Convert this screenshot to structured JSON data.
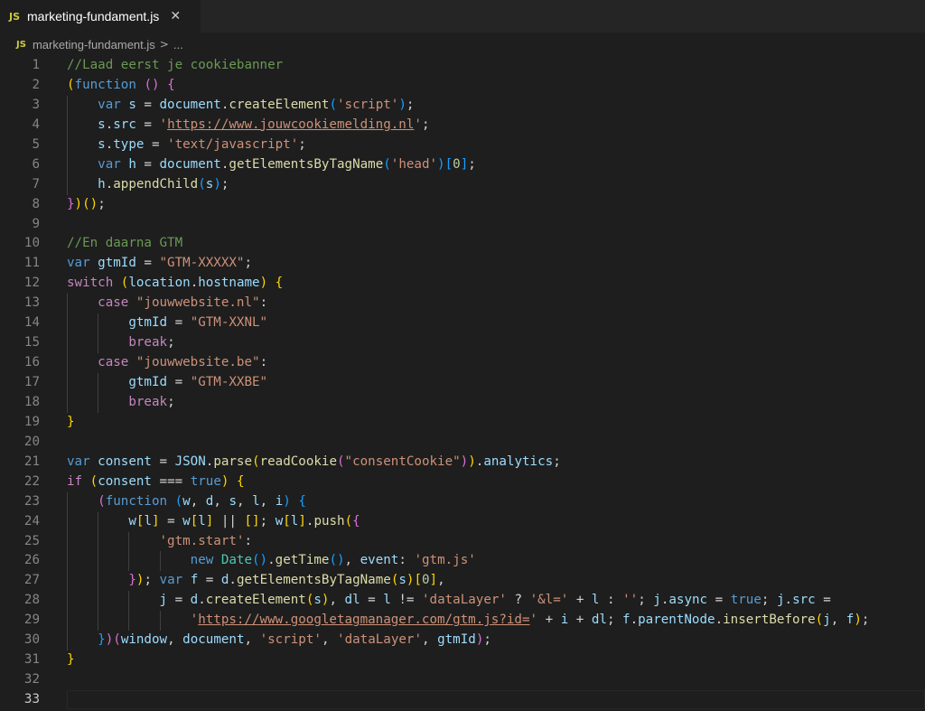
{
  "tab": {
    "badge": "JS",
    "title": "marketing-fundament.js",
    "close_glyph": "✕"
  },
  "breadcrumb": {
    "badge": "JS",
    "file": "marketing-fundament.js",
    "separator": ">",
    "ellipsis": "..."
  },
  "editor": {
    "line_numbers": [
      "1",
      "2",
      "3",
      "4",
      "5",
      "6",
      "7",
      "8",
      "9",
      "10",
      "11",
      "12",
      "13",
      "14",
      "15",
      "16",
      "17",
      "18",
      "19",
      "20",
      "21",
      "22",
      "23",
      "24",
      "25",
      "26",
      "27",
      "28",
      "29",
      "30",
      "31",
      "32",
      "33"
    ],
    "current_line": 33,
    "colors": {
      "background": "#1e1e1e",
      "comment": "#6a9955",
      "keyword": "#569cd6",
      "control": "#c586c0",
      "variable": "#9cdcfe",
      "function": "#dcdcaa",
      "string": "#ce9178",
      "number": "#b5cea8",
      "bracket_gold": "#ffd700",
      "bracket_purple": "#da70d6",
      "bracket_blue": "#179fff"
    },
    "lines": [
      {
        "indent": 0,
        "tokens": [
          [
            "cm",
            "//Laad eerst je cookiebanner"
          ]
        ]
      },
      {
        "indent": 0,
        "tokens": [
          [
            "b1",
            "("
          ],
          [
            "kw",
            "function"
          ],
          [
            "pn",
            " "
          ],
          [
            "b2",
            "()"
          ],
          [
            "pn",
            " "
          ],
          [
            "b2",
            "{"
          ]
        ]
      },
      {
        "indent": 1,
        "tokens": [
          [
            "kw",
            "var"
          ],
          [
            "pn",
            " "
          ],
          [
            "var",
            "s"
          ],
          [
            "pn",
            " = "
          ],
          [
            "var",
            "document"
          ],
          [
            "pn",
            "."
          ],
          [
            "fn",
            "createElement"
          ],
          [
            "b3",
            "("
          ],
          [
            "str",
            "'script'"
          ],
          [
            "b3",
            ")"
          ],
          [
            "pn",
            ";"
          ]
        ]
      },
      {
        "indent": 1,
        "tokens": [
          [
            "var",
            "s"
          ],
          [
            "pn",
            "."
          ],
          [
            "var",
            "src"
          ],
          [
            "pn",
            " = "
          ],
          [
            "str",
            "'"
          ],
          [
            "url",
            "https://www.jouwcookiemelding.nl"
          ],
          [
            "str",
            "'"
          ],
          [
            "pn",
            ";"
          ]
        ]
      },
      {
        "indent": 1,
        "tokens": [
          [
            "var",
            "s"
          ],
          [
            "pn",
            "."
          ],
          [
            "var",
            "type"
          ],
          [
            "pn",
            " = "
          ],
          [
            "str",
            "'text/javascript'"
          ],
          [
            "pn",
            ";"
          ]
        ]
      },
      {
        "indent": 1,
        "tokens": [
          [
            "kw",
            "var"
          ],
          [
            "pn",
            " "
          ],
          [
            "var",
            "h"
          ],
          [
            "pn",
            " = "
          ],
          [
            "var",
            "document"
          ],
          [
            "pn",
            "."
          ],
          [
            "fn",
            "getElementsByTagName"
          ],
          [
            "b3",
            "("
          ],
          [
            "str",
            "'head'"
          ],
          [
            "b3",
            ")"
          ],
          [
            "b3",
            "["
          ],
          [
            "num",
            "0"
          ],
          [
            "b3",
            "]"
          ],
          [
            "pn",
            ";"
          ]
        ]
      },
      {
        "indent": 1,
        "tokens": [
          [
            "var",
            "h"
          ],
          [
            "pn",
            "."
          ],
          [
            "fn",
            "appendChild"
          ],
          [
            "b3",
            "("
          ],
          [
            "var",
            "s"
          ],
          [
            "b3",
            ")"
          ],
          [
            "pn",
            ";"
          ]
        ]
      },
      {
        "indent": 0,
        "tokens": [
          [
            "b2",
            "}"
          ],
          [
            "b1",
            ")"
          ],
          [
            "b1",
            "()"
          ],
          [
            "pn",
            ";"
          ]
        ]
      },
      {
        "indent": 0,
        "tokens": []
      },
      {
        "indent": 0,
        "tokens": [
          [
            "cm",
            "//En daarna GTM"
          ]
        ]
      },
      {
        "indent": 0,
        "tokens": [
          [
            "kw",
            "var"
          ],
          [
            "pn",
            " "
          ],
          [
            "var",
            "gtmId"
          ],
          [
            "pn",
            " = "
          ],
          [
            "str",
            "\"GTM-XXXXX\""
          ],
          [
            "pn",
            ";"
          ]
        ]
      },
      {
        "indent": 0,
        "tokens": [
          [
            "ctl",
            "switch"
          ],
          [
            "pn",
            " "
          ],
          [
            "b1",
            "("
          ],
          [
            "var",
            "location"
          ],
          [
            "pn",
            "."
          ],
          [
            "var",
            "hostname"
          ],
          [
            "b1",
            ")"
          ],
          [
            "pn",
            " "
          ],
          [
            "b1",
            "{"
          ]
        ]
      },
      {
        "indent": 1,
        "tokens": [
          [
            "ctl",
            "case"
          ],
          [
            "pn",
            " "
          ],
          [
            "str",
            "\"jouwwebsite.nl\""
          ],
          [
            "pn",
            ":"
          ]
        ]
      },
      {
        "indent": 2,
        "tokens": [
          [
            "var",
            "gtmId"
          ],
          [
            "pn",
            " = "
          ],
          [
            "str",
            "\"GTM-XXNL\""
          ]
        ]
      },
      {
        "indent": 2,
        "tokens": [
          [
            "ctl",
            "break"
          ],
          [
            "pn",
            ";"
          ]
        ]
      },
      {
        "indent": 1,
        "tokens": [
          [
            "ctl",
            "case"
          ],
          [
            "pn",
            " "
          ],
          [
            "str",
            "\"jouwwebsite.be\""
          ],
          [
            "pn",
            ":"
          ]
        ]
      },
      {
        "indent": 2,
        "tokens": [
          [
            "var",
            "gtmId"
          ],
          [
            "pn",
            " = "
          ],
          [
            "str",
            "\"GTM-XXBE\""
          ]
        ]
      },
      {
        "indent": 2,
        "tokens": [
          [
            "ctl",
            "break"
          ],
          [
            "pn",
            ";"
          ]
        ]
      },
      {
        "indent": 0,
        "tokens": [
          [
            "b1",
            "}"
          ]
        ]
      },
      {
        "indent": 0,
        "tokens": []
      },
      {
        "indent": 0,
        "tokens": [
          [
            "kw",
            "var"
          ],
          [
            "pn",
            " "
          ],
          [
            "var",
            "consent"
          ],
          [
            "pn",
            " = "
          ],
          [
            "var",
            "JSON"
          ],
          [
            "pn",
            "."
          ],
          [
            "fn",
            "parse"
          ],
          [
            "b1",
            "("
          ],
          [
            "fn",
            "readCookie"
          ],
          [
            "b2",
            "("
          ],
          [
            "str",
            "\"consentCookie\""
          ],
          [
            "b2",
            ")"
          ],
          [
            "b1",
            ")"
          ],
          [
            "pn",
            "."
          ],
          [
            "var",
            "analytics"
          ],
          [
            "pn",
            ";"
          ]
        ]
      },
      {
        "indent": 0,
        "tokens": [
          [
            "ctl",
            "if"
          ],
          [
            "pn",
            " "
          ],
          [
            "b1",
            "("
          ],
          [
            "var",
            "consent"
          ],
          [
            "pn",
            " === "
          ],
          [
            "kw",
            "true"
          ],
          [
            "b1",
            ")"
          ],
          [
            "pn",
            " "
          ],
          [
            "b1",
            "{"
          ]
        ]
      },
      {
        "indent": 1,
        "tokens": [
          [
            "b2",
            "("
          ],
          [
            "kw",
            "function"
          ],
          [
            "pn",
            " "
          ],
          [
            "b3",
            "("
          ],
          [
            "var",
            "w"
          ],
          [
            "pn",
            ", "
          ],
          [
            "var",
            "d"
          ],
          [
            "pn",
            ", "
          ],
          [
            "var",
            "s"
          ],
          [
            "pn",
            ", "
          ],
          [
            "var",
            "l"
          ],
          [
            "pn",
            ", "
          ],
          [
            "var",
            "i"
          ],
          [
            "b3",
            ")"
          ],
          [
            "pn",
            " "
          ],
          [
            "b3",
            "{"
          ]
        ]
      },
      {
        "indent": 2,
        "tokens": [
          [
            "var",
            "w"
          ],
          [
            "b1",
            "["
          ],
          [
            "var",
            "l"
          ],
          [
            "b1",
            "]"
          ],
          [
            "pn",
            " = "
          ],
          [
            "var",
            "w"
          ],
          [
            "b1",
            "["
          ],
          [
            "var",
            "l"
          ],
          [
            "b1",
            "]"
          ],
          [
            "pn",
            " || "
          ],
          [
            "b1",
            "[]"
          ],
          [
            "pn",
            "; "
          ],
          [
            "var",
            "w"
          ],
          [
            "b1",
            "["
          ],
          [
            "var",
            "l"
          ],
          [
            "b1",
            "]"
          ],
          [
            "pn",
            "."
          ],
          [
            "fn",
            "push"
          ],
          [
            "b1",
            "("
          ],
          [
            "b2",
            "{"
          ]
        ]
      },
      {
        "indent": 3,
        "tokens": [
          [
            "str",
            "'gtm.start'"
          ],
          [
            "pn",
            ":"
          ]
        ]
      },
      {
        "indent": 4,
        "tokens": [
          [
            "kw",
            "new"
          ],
          [
            "pn",
            " "
          ],
          [
            "cls",
            "Date"
          ],
          [
            "b3",
            "()"
          ],
          [
            "pn",
            "."
          ],
          [
            "fn",
            "getTime"
          ],
          [
            "b3",
            "()"
          ],
          [
            "pn",
            ", "
          ],
          [
            "var",
            "event"
          ],
          [
            "pn",
            ": "
          ],
          [
            "str",
            "'gtm.js'"
          ]
        ]
      },
      {
        "indent": 2,
        "tokens": [
          [
            "b2",
            "}"
          ],
          [
            "b1",
            ")"
          ],
          [
            "pn",
            "; "
          ],
          [
            "kw",
            "var"
          ],
          [
            "pn",
            " "
          ],
          [
            "var",
            "f"
          ],
          [
            "pn",
            " = "
          ],
          [
            "var",
            "d"
          ],
          [
            "pn",
            "."
          ],
          [
            "fn",
            "getElementsByTagName"
          ],
          [
            "b1",
            "("
          ],
          [
            "var",
            "s"
          ],
          [
            "b1",
            ")"
          ],
          [
            "b1",
            "["
          ],
          [
            "num",
            "0"
          ],
          [
            "b1",
            "]"
          ],
          [
            "pn",
            ","
          ]
        ]
      },
      {
        "indent": 3,
        "tokens": [
          [
            "var",
            "j"
          ],
          [
            "pn",
            " = "
          ],
          [
            "var",
            "d"
          ],
          [
            "pn",
            "."
          ],
          [
            "fn",
            "createElement"
          ],
          [
            "b1",
            "("
          ],
          [
            "var",
            "s"
          ],
          [
            "b1",
            ")"
          ],
          [
            "pn",
            ", "
          ],
          [
            "var",
            "dl"
          ],
          [
            "pn",
            " = "
          ],
          [
            "var",
            "l"
          ],
          [
            "pn",
            " != "
          ],
          [
            "str",
            "'dataLayer'"
          ],
          [
            "pn",
            " ? "
          ],
          [
            "str",
            "'&l='"
          ],
          [
            "pn",
            " + "
          ],
          [
            "var",
            "l"
          ],
          [
            "pn",
            " : "
          ],
          [
            "str",
            "''"
          ],
          [
            "pn",
            "; "
          ],
          [
            "var",
            "j"
          ],
          [
            "pn",
            "."
          ],
          [
            "var",
            "async"
          ],
          [
            "pn",
            " = "
          ],
          [
            "kw",
            "true"
          ],
          [
            "pn",
            "; "
          ],
          [
            "var",
            "j"
          ],
          [
            "pn",
            "."
          ],
          [
            "var",
            "src"
          ],
          [
            "pn",
            " ="
          ]
        ]
      },
      {
        "indent": 4,
        "tokens": [
          [
            "str",
            "'"
          ],
          [
            "url",
            "https://www.googletagmanager.com/gtm.js?id="
          ],
          [
            "str",
            "'"
          ],
          [
            "pn",
            " + "
          ],
          [
            "var",
            "i"
          ],
          [
            "pn",
            " + "
          ],
          [
            "var",
            "dl"
          ],
          [
            "pn",
            "; "
          ],
          [
            "var",
            "f"
          ],
          [
            "pn",
            "."
          ],
          [
            "var",
            "parentNode"
          ],
          [
            "pn",
            "."
          ],
          [
            "fn",
            "insertBefore"
          ],
          [
            "b1",
            "("
          ],
          [
            "var",
            "j"
          ],
          [
            "pn",
            ", "
          ],
          [
            "var",
            "f"
          ],
          [
            "b1",
            ")"
          ],
          [
            "pn",
            ";"
          ]
        ]
      },
      {
        "indent": 1,
        "tokens": [
          [
            "b3",
            "}"
          ],
          [
            "b2",
            ")"
          ],
          [
            "b2",
            "("
          ],
          [
            "var",
            "window"
          ],
          [
            "pn",
            ", "
          ],
          [
            "var",
            "document"
          ],
          [
            "pn",
            ", "
          ],
          [
            "str",
            "'script'"
          ],
          [
            "pn",
            ", "
          ],
          [
            "str",
            "'dataLayer'"
          ],
          [
            "pn",
            ", "
          ],
          [
            "var",
            "gtmId"
          ],
          [
            "b2",
            ")"
          ],
          [
            "pn",
            ";"
          ]
        ]
      },
      {
        "indent": 0,
        "tokens": [
          [
            "b1",
            "}"
          ]
        ]
      },
      {
        "indent": 0,
        "tokens": []
      },
      {
        "indent": 0,
        "tokens": []
      }
    ]
  }
}
